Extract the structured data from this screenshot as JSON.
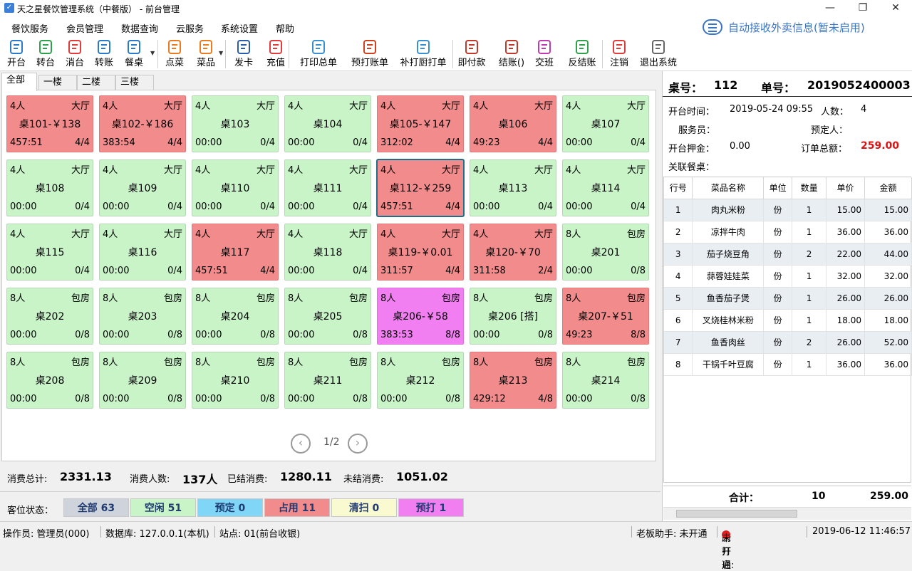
{
  "window": {
    "title": "天之星餐饮管理系统（中餐版） - 前台管理"
  },
  "menu": [
    "餐饮服务",
    "会员管理",
    "数据查询",
    "云服务",
    "系统设置",
    "帮助"
  ],
  "auto_receive": "自动接收外卖信息(暂未启用)",
  "toolbar": [
    {
      "label": "开台",
      "icon": "open-table-icon"
    },
    {
      "label": "转台",
      "icon": "transfer-table-icon"
    },
    {
      "label": "消台",
      "icon": "clear-table-icon"
    },
    {
      "label": "转账",
      "icon": "transfer-bill-icon"
    },
    {
      "label": "餐桌",
      "icon": "tables-icon"
    },
    {
      "label": "点菜",
      "icon": "order-icon"
    },
    {
      "label": "菜品",
      "icon": "dishes-icon"
    },
    {
      "label": "发卡",
      "icon": "card-icon"
    },
    {
      "label": "充值",
      "icon": "recharge-icon"
    },
    {
      "label": "打印总单",
      "icon": "print-icon"
    },
    {
      "label": "预打账单",
      "icon": "preprint-icon"
    },
    {
      "label": "补打厨打单",
      "icon": "chef-print-icon"
    },
    {
      "label": "即付款",
      "icon": "pay-now-icon"
    },
    {
      "label": "结账()",
      "icon": "checkout-icon"
    },
    {
      "label": "交班",
      "icon": "shift-icon"
    },
    {
      "label": "反结账",
      "icon": "reverse-checkout-icon"
    },
    {
      "label": "注销",
      "icon": "logout-icon"
    },
    {
      "label": "退出系统",
      "icon": "exit-icon"
    }
  ],
  "tabs": [
    "全部",
    "一楼",
    "二楼",
    "三楼"
  ],
  "tables": [
    {
      "people": "4人",
      "area": "大厅",
      "name": "桌101-￥138",
      "time": "457:51",
      "seats": "4/4",
      "status": "occ"
    },
    {
      "people": "4人",
      "area": "大厅",
      "name": "桌102-￥186",
      "time": "383:54",
      "seats": "4/4",
      "status": "occ"
    },
    {
      "people": "4人",
      "area": "大厅",
      "name": "桌103",
      "time": "00:00",
      "seats": "0/4",
      "status": "free"
    },
    {
      "people": "4人",
      "area": "大厅",
      "name": "桌104",
      "time": "00:00",
      "seats": "0/4",
      "status": "free"
    },
    {
      "people": "4人",
      "area": "大厅",
      "name": "桌105-￥147",
      "time": "312:02",
      "seats": "4/4",
      "status": "occ"
    },
    {
      "people": "4人",
      "area": "大厅",
      "name": "桌106",
      "time": "49:23",
      "seats": "4/4",
      "status": "occ"
    },
    {
      "people": "4人",
      "area": "大厅",
      "name": "桌107",
      "time": "00:00",
      "seats": "0/4",
      "status": "free"
    },
    {
      "people": "4人",
      "area": "大厅",
      "name": "桌108",
      "time": "00:00",
      "seats": "0/4",
      "status": "free"
    },
    {
      "people": "4人",
      "area": "大厅",
      "name": "桌109",
      "time": "00:00",
      "seats": "0/4",
      "status": "free"
    },
    {
      "people": "4人",
      "area": "大厅",
      "name": "桌110",
      "time": "00:00",
      "seats": "0/4",
      "status": "free"
    },
    {
      "people": "4人",
      "area": "大厅",
      "name": "桌111",
      "time": "00:00",
      "seats": "0/4",
      "status": "free"
    },
    {
      "people": "4人",
      "area": "大厅",
      "name": "桌112-￥259",
      "time": "457:51",
      "seats": "4/4",
      "status": "occ",
      "selected": true
    },
    {
      "people": "4人",
      "area": "大厅",
      "name": "桌113",
      "time": "00:00",
      "seats": "0/4",
      "status": "free"
    },
    {
      "people": "4人",
      "area": "大厅",
      "name": "桌114",
      "time": "00:00",
      "seats": "0/4",
      "status": "free"
    },
    {
      "people": "4人",
      "area": "大厅",
      "name": "桌115",
      "time": "00:00",
      "seats": "0/4",
      "status": "free"
    },
    {
      "people": "4人",
      "area": "大厅",
      "name": "桌116",
      "time": "00:00",
      "seats": "0/4",
      "status": "free"
    },
    {
      "people": "4人",
      "area": "大厅",
      "name": "桌117",
      "time": "457:51",
      "seats": "4/4",
      "status": "occ"
    },
    {
      "people": "4人",
      "area": "大厅",
      "name": "桌118",
      "time": "00:00",
      "seats": "0/4",
      "status": "free"
    },
    {
      "people": "4人",
      "area": "大厅",
      "name": "桌119-￥0.01",
      "time": "311:57",
      "seats": "4/4",
      "status": "occ"
    },
    {
      "people": "4人",
      "area": "大厅",
      "name": "桌120-￥70",
      "time": "311:58",
      "seats": "2/4",
      "status": "occ"
    },
    {
      "people": "8人",
      "area": "包房",
      "name": "桌201",
      "time": "00:00",
      "seats": "0/8",
      "status": "free"
    },
    {
      "people": "8人",
      "area": "包房",
      "name": "桌202",
      "time": "00:00",
      "seats": "0/8",
      "status": "free"
    },
    {
      "people": "8人",
      "area": "包房",
      "name": "桌203",
      "time": "00:00",
      "seats": "0/8",
      "status": "free"
    },
    {
      "people": "8人",
      "area": "包房",
      "name": "桌204",
      "time": "00:00",
      "seats": "0/8",
      "status": "free"
    },
    {
      "people": "8人",
      "area": "包房",
      "name": "桌205",
      "time": "00:00",
      "seats": "0/8",
      "status": "free"
    },
    {
      "people": "8人",
      "area": "包房",
      "name": "桌206-￥58",
      "time": "383:53",
      "seats": "8/8",
      "status": "pre"
    },
    {
      "people": "8人",
      "area": "包房",
      "name": "桌206 [搭]",
      "time": "00:00",
      "seats": "0/8",
      "status": "free"
    },
    {
      "people": "8人",
      "area": "包房",
      "name": "桌207-￥51",
      "time": "49:23",
      "seats": "8/8",
      "status": "occ"
    },
    {
      "people": "8人",
      "area": "包房",
      "name": "桌208",
      "time": "00:00",
      "seats": "0/8",
      "status": "free"
    },
    {
      "people": "8人",
      "area": "包房",
      "name": "桌209",
      "time": "00:00",
      "seats": "0/8",
      "status": "free"
    },
    {
      "people": "8人",
      "area": "包房",
      "name": "桌210",
      "time": "00:00",
      "seats": "0/8",
      "status": "free"
    },
    {
      "people": "8人",
      "area": "包房",
      "name": "桌211",
      "time": "00:00",
      "seats": "0/8",
      "status": "free"
    },
    {
      "people": "8人",
      "area": "包房",
      "name": "桌212",
      "time": "00:00",
      "seats": "0/8",
      "status": "free"
    },
    {
      "people": "8人",
      "area": "包房",
      "name": "桌213",
      "time": "429:12",
      "seats": "4/8",
      "status": "occ"
    },
    {
      "people": "8人",
      "area": "包房",
      "name": "桌214",
      "time": "00:00",
      "seats": "0/8",
      "status": "free"
    }
  ],
  "pager": {
    "text": "1/2"
  },
  "summary": {
    "total_label": "消费总计:",
    "total": "2331.13",
    "people_label": "消费人数:",
    "people": "137人",
    "settled_label": "已结消费:",
    "settled": "1280.11",
    "unsettled_label": "未结消费:",
    "unsettled": "1051.02"
  },
  "legend": {
    "label": "客位状态：",
    "chips": [
      {
        "text": "全部 63",
        "color": "#cfd4dc"
      },
      {
        "text": "空闲 51",
        "color": "#c8f4c8"
      },
      {
        "text": "预定 0",
        "color": "#7fd6f7"
      },
      {
        "text": "占用 11",
        "color": "#f28b8b"
      },
      {
        "text": "清扫 0",
        "color": "#fafad0"
      },
      {
        "text": "预打 1",
        "color": "#f27ff2"
      }
    ]
  },
  "detail": {
    "table_label": "桌号：",
    "table_no": "112",
    "order_label": "单号：",
    "order_no": "2019052400003",
    "open_time_label": "开台时间：",
    "open_time": "2019-05-24 09:55",
    "people_label": "人数：",
    "people": "4",
    "waiter_label": "服务员：",
    "waiter": "",
    "booker_label": "预定人：",
    "booker": "",
    "deposit_label": "开台押金：",
    "deposit": "0.00",
    "total_label": "订单总额：",
    "total": "259.00",
    "linked_label": "关联餐桌：",
    "linked": ""
  },
  "items_table": {
    "headers": [
      "行号",
      "菜品名称",
      "单位",
      "数量",
      "单价",
      "金额"
    ],
    "rows": [
      [
        "1",
        "肉丸米粉",
        "份",
        "1",
        "15.00",
        "15.00"
      ],
      [
        "2",
        "凉拌牛肉",
        "份",
        "1",
        "36.00",
        "36.00"
      ],
      [
        "3",
        "茄子烧豆角",
        "份",
        "2",
        "22.00",
        "44.00"
      ],
      [
        "4",
        "蒜蓉娃娃菜",
        "份",
        "1",
        "32.00",
        "32.00"
      ],
      [
        "5",
        "鱼香茄子煲",
        "份",
        "1",
        "26.00",
        "26.00"
      ],
      [
        "6",
        "叉烧桂林米粉",
        "份",
        "1",
        "18.00",
        "18.00"
      ],
      [
        "7",
        "鱼香肉丝",
        "份",
        "2",
        "26.00",
        "52.00"
      ],
      [
        "8",
        "干锅千叶豆腐",
        "份",
        "1",
        "36.00",
        "36.00"
      ]
    ],
    "total_label": "合计：",
    "total_qty": "10",
    "total_amount": "259.00"
  },
  "statusbar": {
    "operator": "操作员:  管理员(000)",
    "database": "数据库: 127.0.0.1(本机)",
    "station": "站点: 01(前台收银)",
    "boss": "老板助手: 未开通",
    "kitchen": "厨打通: ",
    "kitchen_status": "未开启",
    "datetime": "2019-06-12 11:46:57"
  }
}
